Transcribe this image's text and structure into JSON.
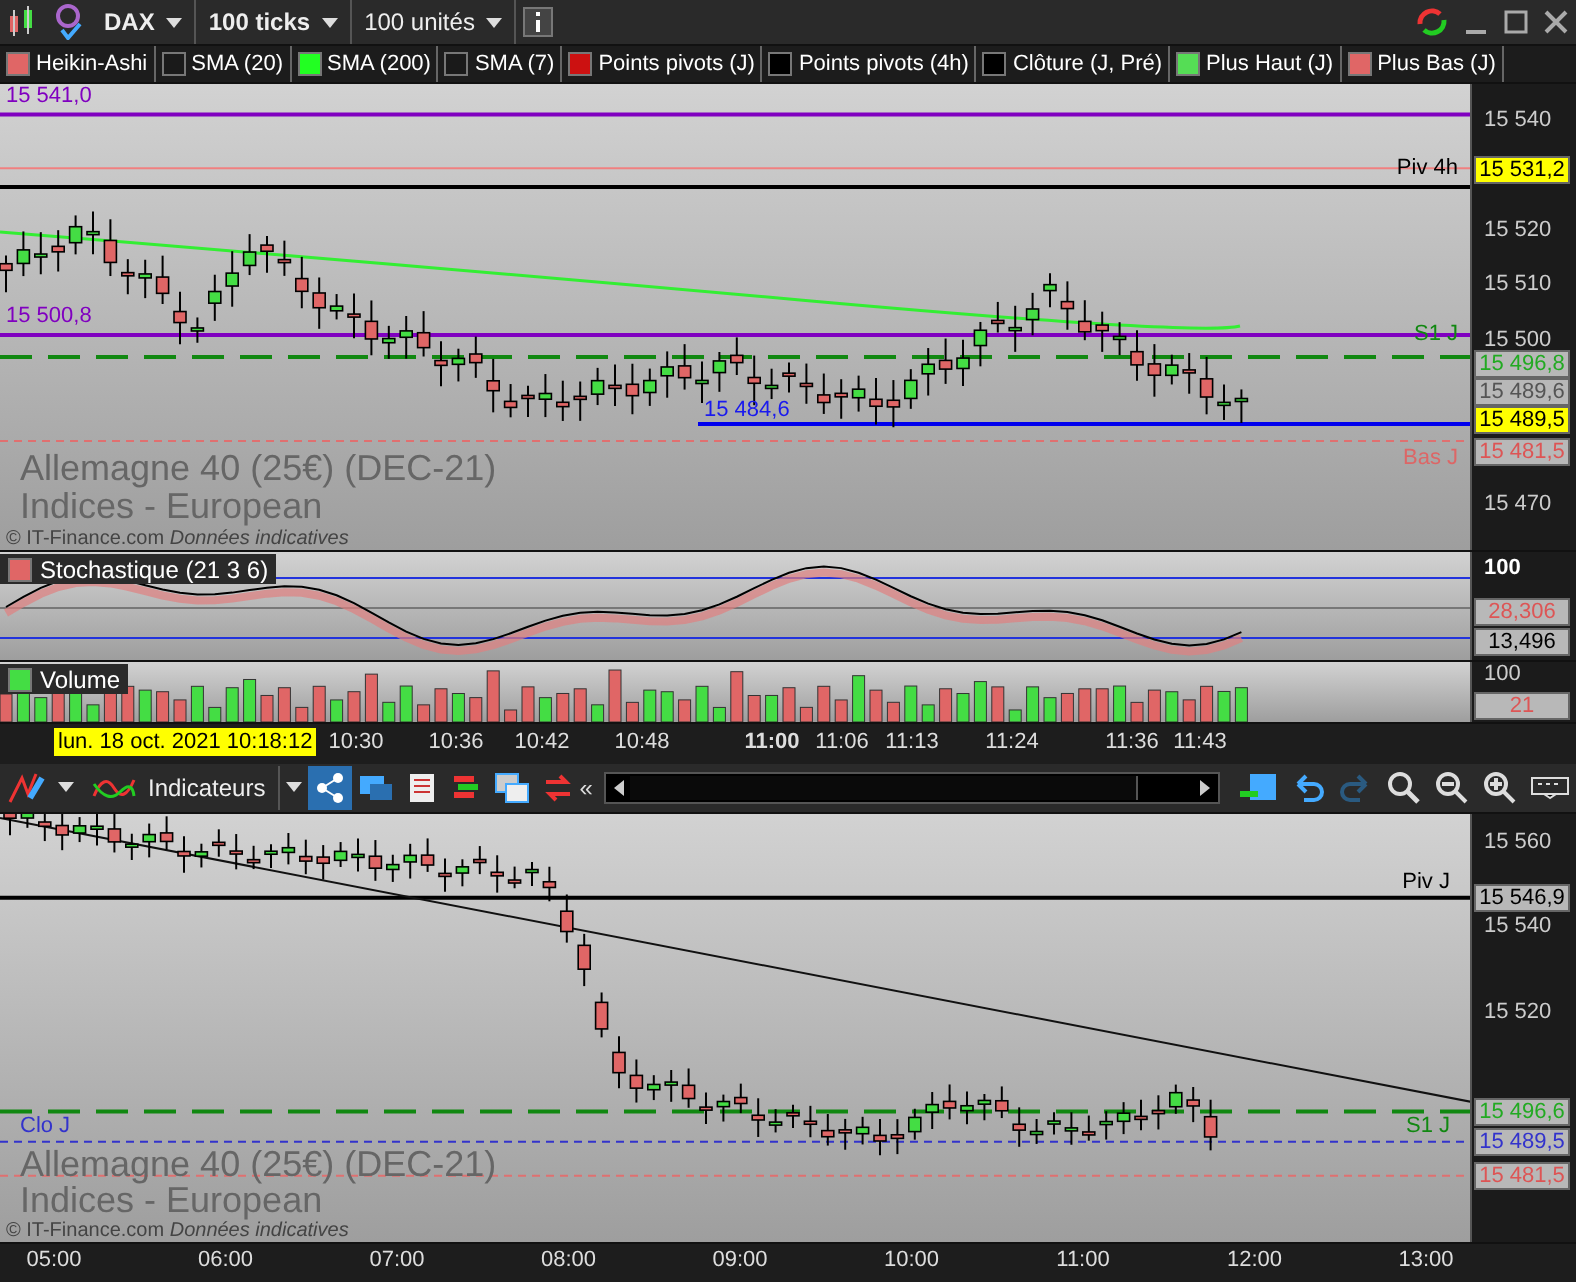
{
  "toolbar": {
    "symbol": "DAX",
    "interval": "100 ticks",
    "units": "100 unités"
  },
  "legend": [
    {
      "label": "Heikin-Ashi",
      "color": "#e06666"
    },
    {
      "label": "SMA (20)",
      "color": "#1a1a1a"
    },
    {
      "label": "SMA (200)",
      "color": "#22ff22"
    },
    {
      "label": "SMA (7)",
      "color": "#1a1a1a"
    },
    {
      "label": "Points pivots (J)",
      "color": "#cc1111"
    },
    {
      "label": "Points pivots (4h)",
      "color": "#000000"
    },
    {
      "label": "Clôture (J, Pré)",
      "color": "#000000"
    },
    {
      "label": "Plus Haut (J)",
      "color": "#55dd55"
    },
    {
      "label": "Plus Bas (J)",
      "color": "#e06666"
    }
  ],
  "main_chart": {
    "left_labels": [
      "15 541,0",
      "15 500,8"
    ],
    "marker_label": "15 484,6",
    "line_labels": [
      "Piv 4h",
      "S1 J",
      "Bas J"
    ],
    "axis_ticks": [
      "15 540",
      "15 520",
      "15 510",
      "15 500",
      "15 470"
    ],
    "price_tags": [
      {
        "text": "15 531,2",
        "kind": "highlight"
      },
      {
        "text": "15 496,8",
        "kind": "box",
        "color": "#22aa22"
      },
      {
        "text": "15 489,6",
        "kind": "box",
        "color": "#555555"
      },
      {
        "text": "15 489,5",
        "kind": "highlight"
      },
      {
        "text": "15 481,5",
        "kind": "box",
        "color": "#dd5555"
      }
    ],
    "watermark": [
      "Allemagne 40 (25€) (DEC-21)",
      "Indices - European"
    ],
    "credit": "© IT-Finance.com",
    "credit_note": "Données indicatives"
  },
  "stochastic": {
    "title": "Stochastique (21 3 6)",
    "axis_tick": "100",
    "tags": [
      {
        "text": "28,306",
        "color": "#dd5555"
      },
      {
        "text": "13,496",
        "color": "#000000"
      }
    ]
  },
  "volume": {
    "title": "Volume",
    "axis_tick": "100",
    "tag": "21"
  },
  "time_axis": {
    "cursor": "lun. 18 oct. 2021 10:18:12",
    "ticks": [
      {
        "label": "10:30",
        "bold": false
      },
      {
        "label": "10:36",
        "bold": false
      },
      {
        "label": "10:42",
        "bold": false
      },
      {
        "label": "10:48",
        "bold": false
      },
      {
        "label": "11:00",
        "bold": true
      },
      {
        "label": "11:06",
        "bold": false
      },
      {
        "label": "11:13",
        "bold": false
      },
      {
        "label": "11:24",
        "bold": false
      },
      {
        "label": "11:36",
        "bold": false
      },
      {
        "label": "11:43",
        "bold": false
      }
    ]
  },
  "toolbar2": {
    "indicators": "Indicateurs",
    "collapse": "«"
  },
  "chart2": {
    "line_labels": [
      "Piv J",
      "S1 J",
      "Clo J"
    ],
    "axis_ticks": [
      "15 560",
      "15 540",
      "15 520"
    ],
    "price_tags": [
      {
        "text": "15 546,9",
        "color": "#000000"
      },
      {
        "text": "15 496,6",
        "color": "#22aa22"
      },
      {
        "text": "15 489,5",
        "color": "#3333cc"
      },
      {
        "text": "15 481,5",
        "color": "#dd5555"
      }
    ],
    "watermark": [
      "Allemagne 40 (25€) (DEC-21)",
      "Indices - European"
    ],
    "credit": "© IT-Finance.com",
    "credit_note": "Données indicatives"
  },
  "time_axis2": [
    "05:00",
    "06:00",
    "07:00",
    "08:00",
    "09:00",
    "10:00",
    "11:00",
    "12:00",
    "13:00"
  ]
}
